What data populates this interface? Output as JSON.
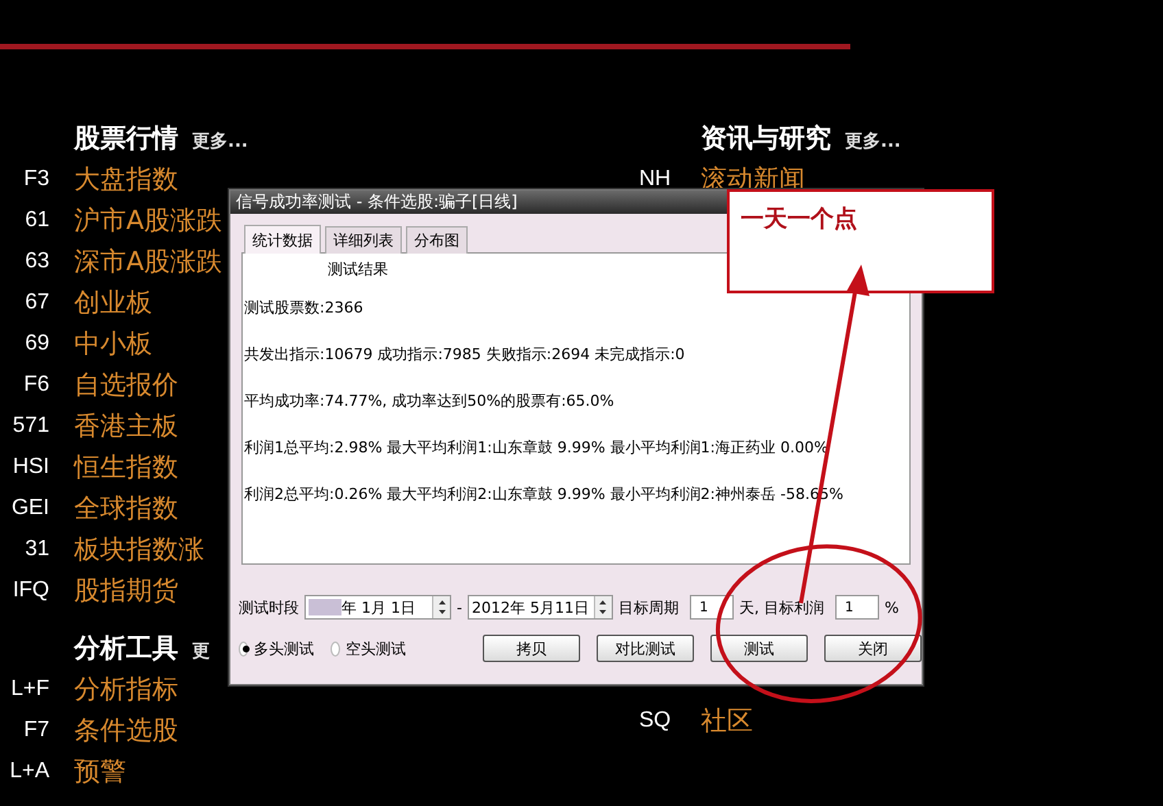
{
  "market_section": {
    "title": "股票行情",
    "more": "更多...",
    "items": [
      {
        "code": "F3",
        "label": "大盘指数"
      },
      {
        "code": "61",
        "label": "沪市A股涨跌"
      },
      {
        "code": "63",
        "label": "深市A股涨跌"
      },
      {
        "code": "67",
        "label": "创业板"
      },
      {
        "code": "69",
        "label": "中小板"
      },
      {
        "code": "F6",
        "label": "自选报价"
      },
      {
        "code": "571",
        "label": "香港主板"
      },
      {
        "code": "HSI",
        "label": "恒生指数"
      },
      {
        "code": "GEI",
        "label": "全球指数"
      },
      {
        "code": "31",
        "label": "板块指数涨"
      },
      {
        "code": "IFQ",
        "label": "股指期货"
      }
    ]
  },
  "analysis_section": {
    "title": "分析工具",
    "more": "更",
    "items": [
      {
        "code": "L+F",
        "label": "分析指标"
      },
      {
        "code": "F7",
        "label": "条件选股"
      },
      {
        "code": "L+A",
        "label": "预警"
      }
    ]
  },
  "news_section": {
    "title": "资讯与研究",
    "more": "更多...",
    "items": [
      {
        "code": "NH",
        "label": "滚动新闻"
      },
      {
        "code": "SQ",
        "label": "社区"
      }
    ]
  },
  "dialog": {
    "title": "信号成功率测试 - 条件选股:骗子[日线]",
    "tabs": [
      {
        "label": "统计数据",
        "selected": true
      },
      {
        "label": "详细列表",
        "selected": false
      },
      {
        "label": "分布图",
        "selected": false
      }
    ],
    "results": {
      "heading": "测试结果",
      "lines": [
        "测试股票数:2366",
        "共发出指示:10679 成功指示:7985 失败指示:2694 未完成指示:0",
        "平均成功率:74.77%, 成功率达到50%的股票有:65.0%",
        "利润1总平均:2.98% 最大平均利润1:山东章鼓 9.99% 最小平均利润1:海正药业 0.00%",
        "利润2总平均:0.26% 最大平均利润2:山东章鼓 9.99% 最小平均利润2:神州泰岳 -58.65%"
      ]
    },
    "period": {
      "label": "测试时段",
      "start_date": "年 1月 1日",
      "separator": "-",
      "end_date": "2012年 5月11日"
    },
    "target": {
      "period_label": "目标周期",
      "period_value": "1",
      "profit_label": "天, 目标利润",
      "profit_value": "1",
      "unit": "%"
    },
    "modes": [
      {
        "label": "多头测试",
        "selected": true
      },
      {
        "label": "空头测试",
        "selected": false
      }
    ],
    "buttons": [
      "拷贝",
      "对比测试",
      "测试",
      "关闭"
    ]
  },
  "annotation": {
    "note": "一天一个点"
  }
}
